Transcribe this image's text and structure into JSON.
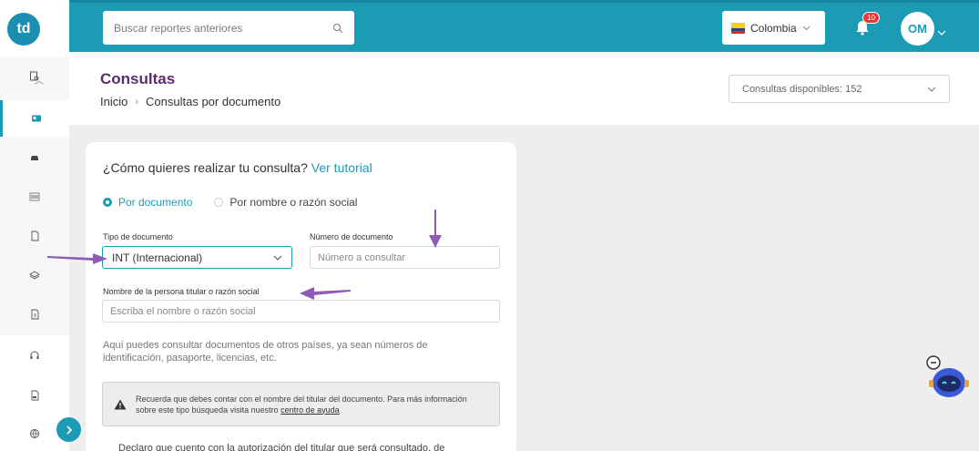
{
  "header": {
    "search_placeholder": "Buscar reportes anteriores",
    "country": "Colombia",
    "notification_count": "10",
    "avatar_initials": "OM",
    "accent": "#1c9bb5"
  },
  "titlebar": {
    "title": "Consultas",
    "breadcrumb": [
      "Inicio",
      "Consultas por documento"
    ],
    "available": "Consultas disponibles: 152"
  },
  "card": {
    "question": "¿Cómo quieres realizar tu consulta?",
    "tutorial_link": "Ver tutorial",
    "radio_doc": "Por documento",
    "radio_name": "Por nombre o razón social",
    "doc_type_label": "Tipo de documento",
    "doc_type_value": "INT (Internacional)",
    "doc_number_label": "Número de documento",
    "doc_number_placeholder": "Número a consultar",
    "name_label": "Nombre de la persona titular o razón social",
    "name_placeholder": "Escriba el nombre o razón social",
    "help_text": "Aquí puedes consultar documentos de otros países, ya sean números de identificación, pasaporte, licencias, etc.",
    "warning_text": "Recuerda que debes contar con el nombre del titular del documento. Para más información sobre este tipo búsqueda visita nuestro",
    "warning_link": "centro de ayuda",
    "declare_text": "Declaro que cuento con la autorización del titular que será consultado, de"
  },
  "icons": [
    "logo-icon",
    "document-search-icon",
    "id-card-icon",
    "car-icon",
    "barcode-icon",
    "file-icon",
    "layers-icon",
    "report-icon",
    "headset-icon",
    "pdf-icon",
    "globe-icon",
    "chevron-right-icon",
    "search-icon",
    "bell-icon",
    "chevron-down-icon",
    "warning-icon",
    "chatbot-icon"
  ]
}
